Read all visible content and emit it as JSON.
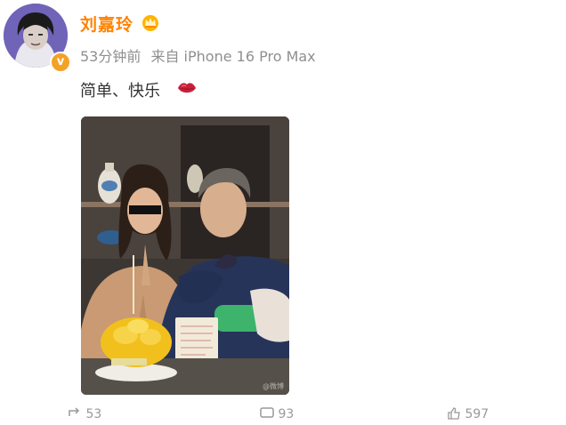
{
  "post": {
    "author": "刘嘉玲",
    "time": "53分钟前",
    "source": "来自 iPhone 16 Pro Max",
    "text": "简单、快乐",
    "emoji": "lips-emoji",
    "photo_watermark": "@微博"
  },
  "actions": {
    "repost_count": "53",
    "comment_count": "93",
    "like_count": "597"
  },
  "colors": {
    "username": "#ff8200",
    "meta": "#8f8f8f",
    "verify_badge": "#f2a227"
  }
}
